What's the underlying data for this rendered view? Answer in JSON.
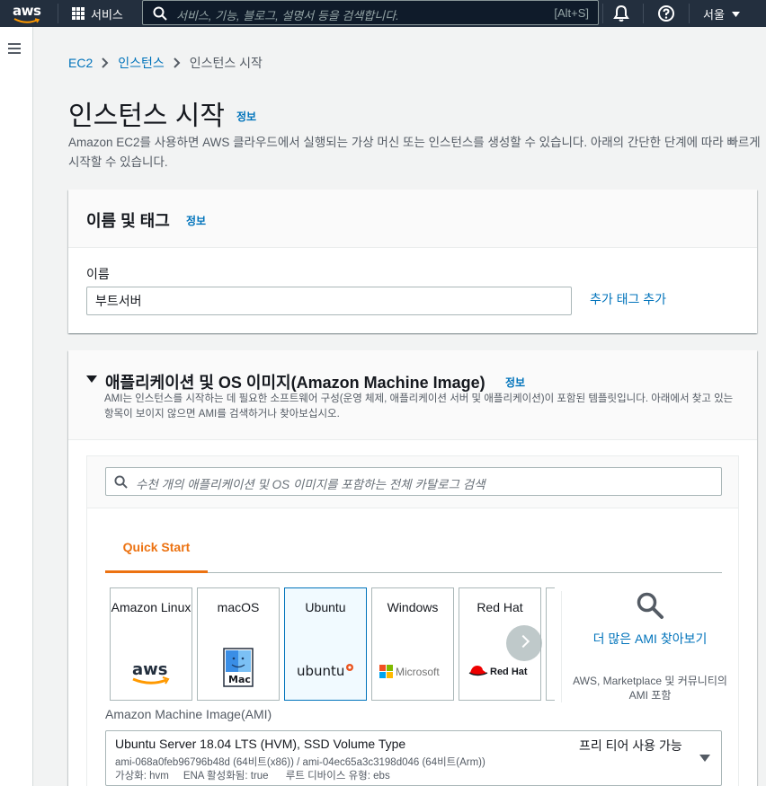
{
  "topnav": {
    "logo_text": "aws",
    "services_label": "서비스",
    "search_placeholder": "서비스, 기능, 블로그, 설명서 등을 검색합니다.",
    "search_shortcut": "[Alt+S]",
    "region": "서울"
  },
  "breadcrumb": {
    "items": [
      "EC2",
      "인스턴스",
      "인스턴스 시작"
    ]
  },
  "page": {
    "title": "인스턴스 시작",
    "info": "정보",
    "description": "Amazon EC2를 사용하면 AWS 클라우드에서 실행되는 가상 머신 또는 인스턴스를 생성할 수 있습니다. 아래의 간단한 단계에 따라 빠르게 시작할 수 있습니다."
  },
  "name_tags": {
    "heading": "이름 및 태그",
    "info": "정보",
    "name_label": "이름",
    "name_value": "부트서버",
    "add_tags": "추가 태그 추가"
  },
  "ami_section": {
    "heading": "애플리케이션 및 OS 이미지(Amazon Machine Image)",
    "info": "정보",
    "description": "AMI는 인스턴스를 시작하는 데 필요한 소프트웨어 구성(운영 체제, 애플리케이션 서버 및 애플리케이션)이 포함된 템플릿입니다. 아래에서 찾고 있는 항목이 보이지 않으면 AMI를 검색하거나 찾아보십시오.",
    "search_placeholder": "수천 개의 애플리케이션 및 OS 이미지를 포함하는 전체 카탈로그 검색",
    "tab": "Quick Start",
    "os_options": [
      {
        "name": "Amazon Linux",
        "logo": "aws"
      },
      {
        "name": "macOS",
        "logo": "Mac"
      },
      {
        "name": "Ubuntu",
        "logo": "ubuntu",
        "selected": true
      },
      {
        "name": "Windows",
        "logo": "Microsoft"
      },
      {
        "name": "Red Hat",
        "logo": "Red Hat"
      }
    ],
    "more_ami_link": "더 많은 AMI 찾아보기",
    "more_ami_sub": "AWS, Marketplace 및 커뮤니티의 AMI 포함",
    "ami_label": "Amazon Machine Image(AMI)",
    "selected_ami": {
      "name": "Ubuntu Server 18.04 LTS (HVM), SSD Volume Type",
      "ids": "ami-068a0feb96796b48d (64비트(x86)) / ami-04ec65a3c3198d046 (64비트(Arm))",
      "meta": "가상화: hvm     ENA 활성화됨: true      루트 디바이스 유형: ebs",
      "tier": "프리 티어 사용 가능"
    }
  }
}
